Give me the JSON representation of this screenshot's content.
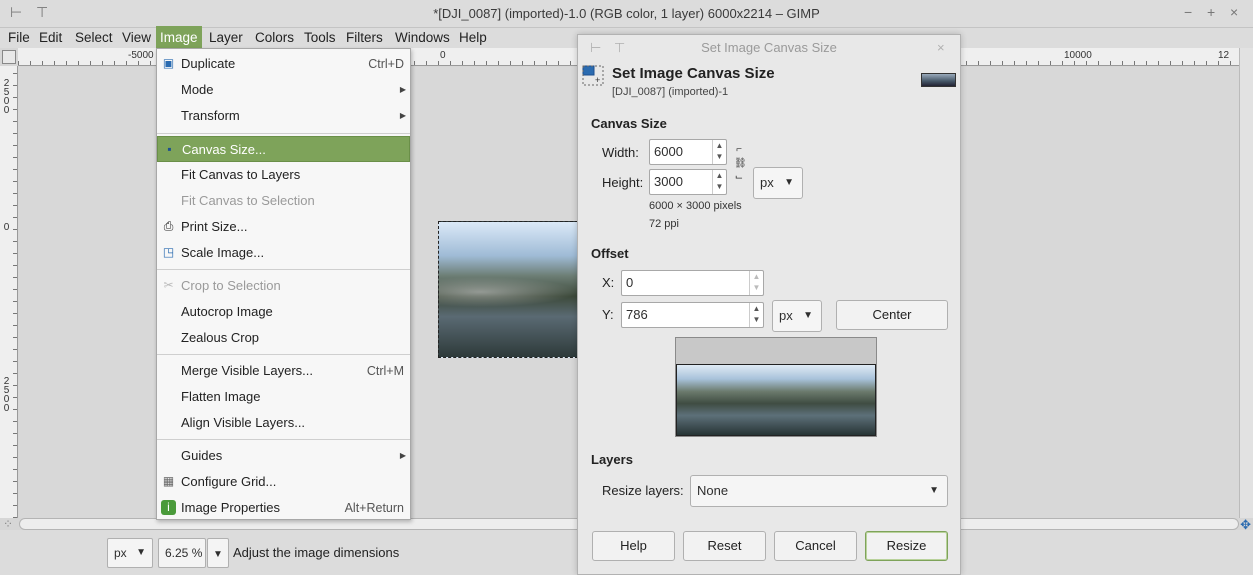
{
  "window": {
    "title": "*[DJI_0087] (imported)-1.0 (RGB color, 1 layer) 6000x2214 – GIMP"
  },
  "menubar": {
    "items": [
      "File",
      "Edit",
      "Select",
      "View",
      "Image",
      "Layer",
      "Colors",
      "Tools",
      "Filters",
      "Windows",
      "Help"
    ],
    "active": "Image"
  },
  "ruler": {
    "top_labels": [
      "-5000",
      "0",
      "10000",
      "12"
    ],
    "left_labels": [
      "2500",
      "0",
      "2500"
    ]
  },
  "image_menu": {
    "items": [
      {
        "label": "Duplicate",
        "accel": "Ctrl+D"
      },
      {
        "label": "Mode",
        "submenu": true
      },
      {
        "label": "Transform",
        "submenu": true
      },
      {
        "label": "Canvas Size...",
        "highlighted": true
      },
      {
        "label": "Fit Canvas to Layers"
      },
      {
        "label": "Fit Canvas to Selection",
        "disabled": true
      },
      {
        "label": "Print Size..."
      },
      {
        "label": "Scale Image..."
      },
      {
        "label": "Crop to Selection",
        "disabled": true
      },
      {
        "label": "Autocrop Image"
      },
      {
        "label": "Zealous Crop"
      },
      {
        "label": "Merge Visible Layers...",
        "accel": "Ctrl+M"
      },
      {
        "label": "Flatten Image"
      },
      {
        "label": "Align Visible Layers..."
      },
      {
        "label": "Guides",
        "submenu": true
      },
      {
        "label": "Configure Grid..."
      },
      {
        "label": "Image Properties",
        "accel": "Alt+Return"
      }
    ]
  },
  "statusbar": {
    "unit": "px",
    "zoom": "6.25 %",
    "message": "Adjust the image dimensions"
  },
  "dialog": {
    "window_title": "Set Image Canvas Size",
    "heading": "Set Image Canvas Size",
    "subheading": "[DJI_0087] (imported)-1",
    "canvas_size_label": "Canvas Size",
    "width_label": "Width:",
    "width_value": "6000",
    "height_label": "Height:",
    "height_value": "3000",
    "size_unit": "px",
    "pixels_info": "6000 × 3000 pixels",
    "ppi_info": "72 ppi",
    "offset_label": "Offset",
    "x_label": "X:",
    "x_value": "0",
    "y_label": "Y:",
    "y_value": "786",
    "offset_unit": "px",
    "center_button": "Center",
    "layers_label": "Layers",
    "resize_layers_label": "Resize layers:",
    "resize_layers_value": "None",
    "buttons": {
      "help": "Help",
      "reset": "Reset",
      "cancel": "Cancel",
      "resize": "Resize"
    }
  },
  "colors": {
    "accent": "#7ea35a"
  }
}
